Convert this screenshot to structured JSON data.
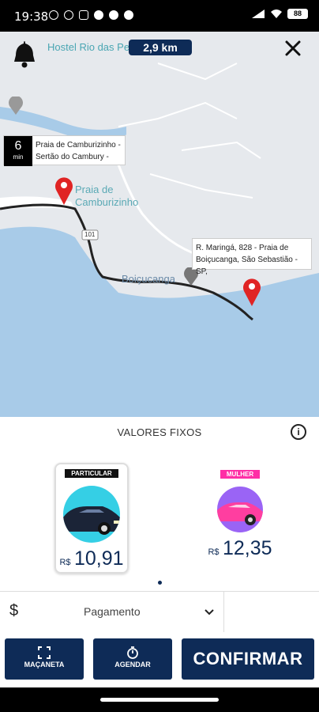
{
  "status": {
    "time": "19:38",
    "battery": "88"
  },
  "map": {
    "top_place": "Hostel Rio das Pedras",
    "distance": "2,9 km",
    "eta": {
      "value": "6",
      "unit": "min",
      "line1": "Praia de Camburizinho -",
      "line2": "Sertão do Cambury -"
    },
    "destination": {
      "line1": "R. Maringá, 828 - Praia de",
      "line2": "Boiçucanga, São Sebastião - SP,"
    },
    "labels": {
      "praia1": "Praia de",
      "praia2": "Camburizinho",
      "boicucanga": "Boiçucanga",
      "road": "101"
    }
  },
  "fixed": {
    "title": "VALORES FIXOS",
    "info_glyph": "i"
  },
  "cards": [
    {
      "tag": "PARTICULAR",
      "currency": "R$",
      "price": "10,91"
    },
    {
      "tag": "MULHER",
      "currency": "R$",
      "price": "12,35"
    }
  ],
  "payment": {
    "symbol": "$",
    "label": "Pagamento"
  },
  "buttons": {
    "maçaneta": "MAÇANETA",
    "agendar": "AGENDAR",
    "confirmar": "CONFIRMAR"
  },
  "colors": {
    "primary": "#0e2b57",
    "pink": "#ff2ea6",
    "cyan": "#35cfe5",
    "pin": "#e02424"
  }
}
